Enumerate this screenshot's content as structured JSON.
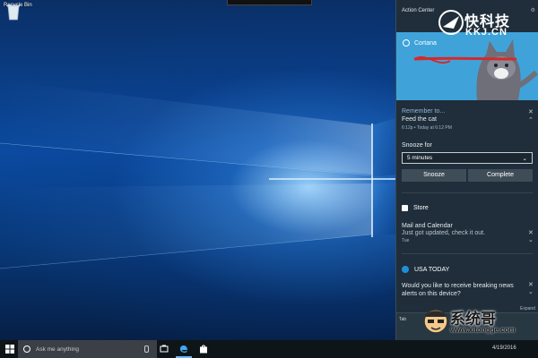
{
  "desktop": {
    "recycle_bin_label": "Recycle Bin"
  },
  "action_center": {
    "title": "Action Center",
    "cortana": {
      "name": "Cortana"
    },
    "reminder": {
      "title": "Remember to...",
      "body": "Feed the cat",
      "time": "6:12p • Today at 6:12 PM",
      "snooze_label": "Snooze for",
      "snooze_value": "5 minutes",
      "snooze_button": "Snooze",
      "complete_button": "Complete"
    },
    "store": {
      "app_name": "Store",
      "title": "Mail and Calendar",
      "body": "Just got updated, check it out.",
      "day": "Tue"
    },
    "usa_today": {
      "app_name": "USA TODAY",
      "body": "Would you like to receive breaking news alerts on this device?",
      "side_label": "Expand"
    },
    "footer_tile": "Tab"
  },
  "taskbar": {
    "search_placeholder": "Ask me anything",
    "date": "4/19/2016"
  },
  "watermarks": {
    "top_cn": "快科技",
    "top_en": "KKJ.CN",
    "bottom_cn": "系统哥",
    "bottom_en": "www.xitongge.com"
  }
}
